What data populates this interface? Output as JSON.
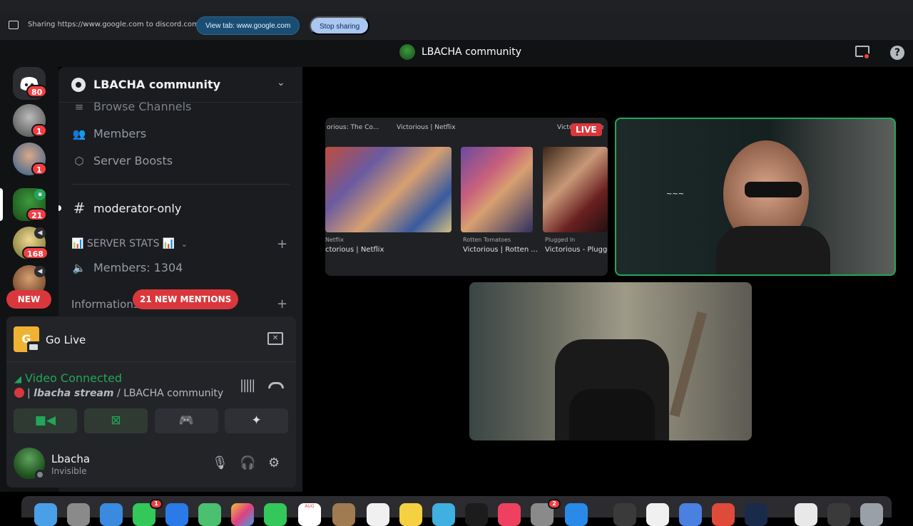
{
  "browser": {
    "sharing_text": "Sharing https://www.google.com to discord.com",
    "view_tab_label": "View tab: www.google.com",
    "stop_sharing_label": "Stop sharing"
  },
  "titlebar": {
    "title": "LBACHA community"
  },
  "guilds": {
    "home_badge": "80",
    "items": [
      {
        "badge": "1"
      },
      {
        "badge": "1"
      },
      {
        "badge": "21"
      },
      {
        "badge": "168"
      }
    ],
    "new_label": "NEW"
  },
  "sidebar": {
    "server_name": "LBACHA community",
    "browse_channels": "Browse Channels",
    "members": "Members",
    "server_boosts": "Server Boosts",
    "moderator_channel": "moderator-only",
    "stats_category": "📊 SERVER STATS 📊",
    "members_count": "Members: 1304",
    "informations": "Informations",
    "new_mentions": "21 NEW MENTIONS"
  },
  "panel": {
    "go_live": "Go Live",
    "go_live_letter": "G",
    "video_connected": "Video Connected",
    "stream_name": "lbacha stream",
    "stream_server": " / LBACHA community",
    "username": "Lbacha",
    "user_status": "Invisible"
  },
  "stream": {
    "live_label": "LIVE",
    "captions": [
      "orious: The Co...",
      "Victorious | Netflix",
      "Victorious | Ne"
    ],
    "sources": [
      "Netflix",
      "Rotten Tomatoes",
      "Plugged In"
    ],
    "titles": [
      "ctorious | Netflix",
      "Victorious | Rotten ...",
      "Victorious - Plugged"
    ]
  },
  "dock": {
    "messages_badge": "1",
    "settings_badge": "2",
    "calendar_month": "AUG"
  }
}
